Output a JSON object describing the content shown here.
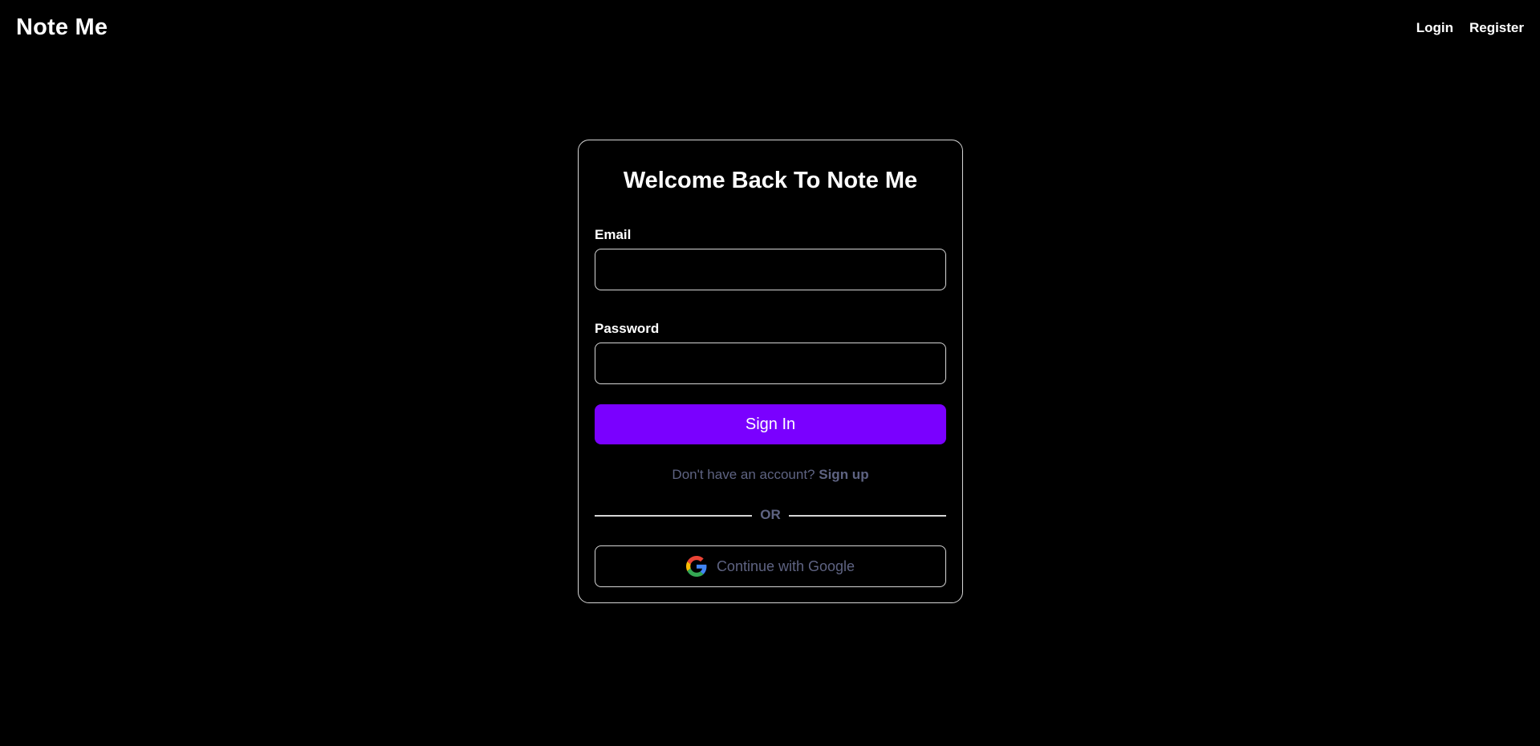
{
  "header": {
    "brand": "Note Me",
    "nav": {
      "login": "Login",
      "register": "Register"
    }
  },
  "login_card": {
    "title": "Welcome Back To Note Me",
    "email": {
      "label": "Email",
      "value": "",
      "placeholder": ""
    },
    "password": {
      "label": "Password",
      "value": "",
      "placeholder": ""
    },
    "submit_label": "Sign In",
    "signup_prompt": "Don't have an account?",
    "signup_link": "Sign up",
    "divider_text": "OR",
    "google_button": {
      "label": "Continue with Google",
      "icon": "google-icon"
    }
  },
  "colors": {
    "background": "#000000",
    "accent": "#7a00ff",
    "muted_text": "#5e6382",
    "border": "#d6d6d6"
  }
}
